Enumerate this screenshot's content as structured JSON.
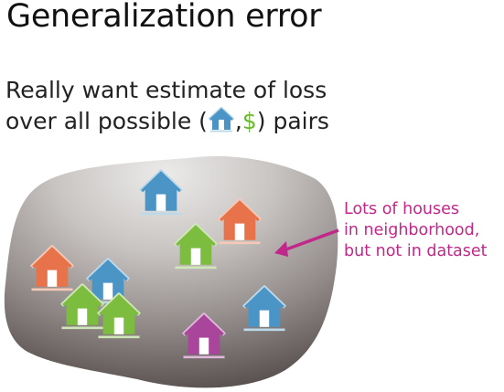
{
  "slide": {
    "title": "Generalization error",
    "line1": "Really want estimate of loss",
    "line2_prefix": "over all possible (",
    "line2_comma": ",",
    "line2_dollar": "$",
    "line2_suffix": ") pairs",
    "inline_icon": "house-icon"
  },
  "annotation": {
    "lines": [
      "Lots of houses",
      "in neighborhood,",
      "but not in dataset"
    ],
    "color": "#c0288a"
  },
  "colors": {
    "blob_top": "#e8e6e5",
    "blob_bottom": "#5a5453",
    "house_blue": "#4b95c6",
    "house_orange": "#e8734a",
    "house_green": "#7cbd3f",
    "house_purple": "#a9459b",
    "dollar": "#6ab82f"
  },
  "houses": [
    {
      "color": "blue"
    },
    {
      "color": "orange"
    },
    {
      "color": "green"
    },
    {
      "color": "orange"
    },
    {
      "color": "blue"
    },
    {
      "color": "green"
    },
    {
      "color": "green"
    },
    {
      "color": "purple"
    },
    {
      "color": "blue"
    }
  ]
}
